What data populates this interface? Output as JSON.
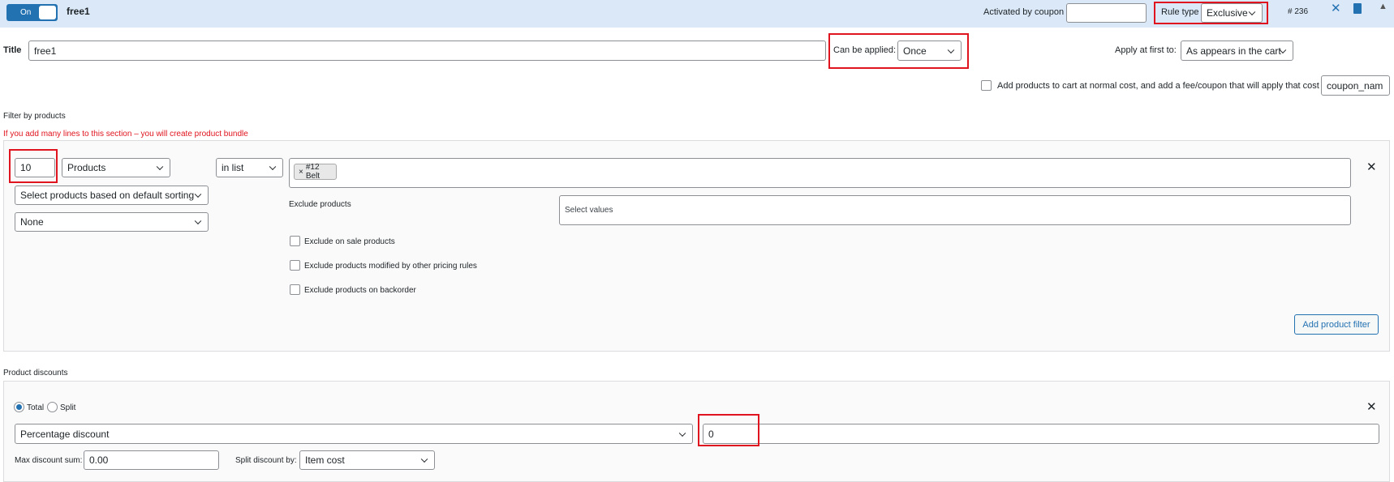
{
  "header": {
    "toggle_label": "On",
    "rule_name": "free1",
    "coupon_label": "Activated by coupon",
    "coupon_value": "",
    "rule_type_label": "Rule type",
    "rule_type_value": "Exclusive",
    "rule_id": "# 236"
  },
  "title_row": {
    "title_label": "Title",
    "title_value": "free1",
    "can_be_applied_label": "Can be applied:",
    "can_be_applied_value": "Once",
    "apply_first_label": "Apply at first to:",
    "apply_first_value": "As appears in the cart"
  },
  "cart_option": {
    "label": "Add products to cart at normal cost, and add a fee/coupon that will apply that cost",
    "coupon_field_value": "coupon_nam"
  },
  "filter": {
    "section_label": "Filter by products",
    "warning": "If you add many lines to this section – you will create product bundle",
    "qty_value": "10",
    "type_value": "Products",
    "method_value": "in list",
    "tag_label": "#12 Belt",
    "tag_remove": "×",
    "sorting_value": "Select products based on default sorting",
    "none_value": "None",
    "exclude_label": "Exclude products",
    "exclude_placeholder": "Select values",
    "exclude_on_sale": "Exclude on sale products",
    "exclude_modified": "Exclude products modified by other pricing rules",
    "exclude_backorder": "Exclude products on backorder",
    "add_filter_button": "Add product filter"
  },
  "discounts": {
    "section_label": "Product discounts",
    "radio_total": "Total",
    "radio_split": "Split",
    "discount_type_value": "Percentage discount",
    "discount_amount_value": "0",
    "max_sum_label": "Max discount sum:",
    "max_sum_value": "0.00",
    "split_by_label": "Split discount by:",
    "split_by_value": "Item cost"
  },
  "colors": {
    "accent": "#2271b1",
    "highlight": "#e0141e",
    "header_bg": "#dbe8f7",
    "warning": "#e0141e"
  }
}
